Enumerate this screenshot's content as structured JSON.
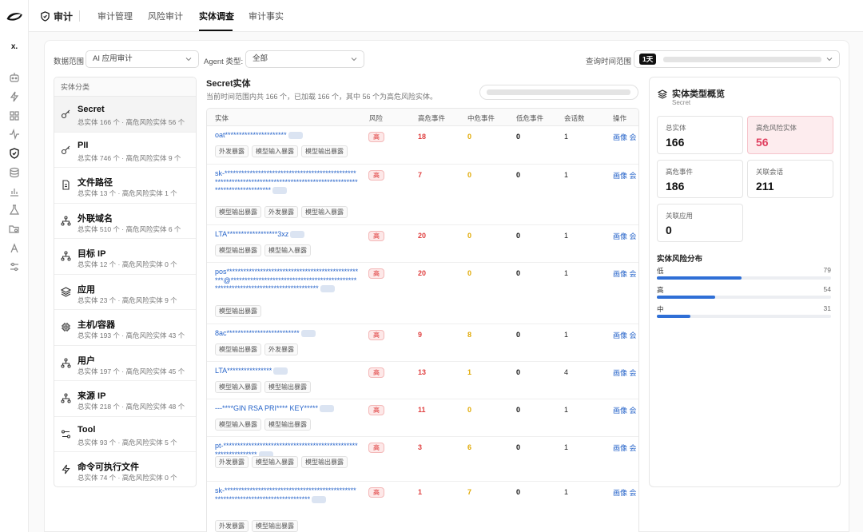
{
  "nav": {
    "brand_label": "审计",
    "tabs": [
      {
        "label": "审计管理"
      },
      {
        "label": "风险审计"
      },
      {
        "label": "实体调查"
      },
      {
        "label": "审计事实"
      }
    ],
    "active_tab": "实体调查"
  },
  "rail": {
    "workspace_badge": "x.",
    "icons": [
      "robot-icon",
      "bolt-icon",
      "grid-icon",
      "pulse-icon",
      "shield-check-icon",
      "database-icon",
      "bar-chart-icon",
      "flask-icon",
      "folder-search-icon",
      "activity-icon",
      "sliders-icon"
    ],
    "active_icon": "shield-check-icon"
  },
  "filters": {
    "scope_label": "数据范围",
    "scope_value": "AI 应用审计",
    "agent_label": "Agent 类型:",
    "agent_value": "全部",
    "time_label": "查询时间范围",
    "time_badge": "1天"
  },
  "categories": {
    "header": "实体分类",
    "selected": "Secret",
    "items": [
      {
        "name": "Secret",
        "summary": "总实体 166 个 · 高危风险实体 56 个",
        "icon": "key-icon"
      },
      {
        "name": "PII",
        "summary": "总实体 746 个 · 高危风险实体 9 个",
        "icon": "key-icon"
      },
      {
        "name": "文件路径",
        "summary": "总实体 13 个 · 高危风险实体 1 个",
        "icon": "file-icon"
      },
      {
        "name": "外联域名",
        "summary": "总实体 510 个 · 高危风险实体 6 个",
        "icon": "network-icon"
      },
      {
        "name": "目标 IP",
        "summary": "总实体 12 个 · 高危风险实体 0 个",
        "icon": "network-icon"
      },
      {
        "name": "应用",
        "summary": "总实体 23 个 · 高危风险实体 9 个",
        "icon": "layers-icon"
      },
      {
        "name": "主机/容器",
        "summary": "总实体 193 个 · 高危风险实体 43 个",
        "icon": "chip-icon"
      },
      {
        "name": "用户",
        "summary": "总实体 197 个 · 高危风险实体 45 个",
        "icon": "network-icon"
      },
      {
        "name": "来源 IP",
        "summary": "总实体 218 个 · 高危风险实体 48 个",
        "icon": "network-icon"
      },
      {
        "name": "Tool",
        "summary": "总实体 93 个 · 高危风险实体 5 个",
        "icon": "tool-icon"
      },
      {
        "name": "命令可执行文件",
        "summary": "总实体 74 个 · 高危风险实体 0 个",
        "icon": "bolt-icon"
      }
    ]
  },
  "entities": {
    "title": "Secret实体",
    "subtitle": "当前时间范围内共 166 个，已加载 166 个，其中 56 个为高危风险实体。",
    "columns": [
      "实体",
      "风险",
      "高危事件",
      "中危事件",
      "低危事件",
      "会话数",
      "操作"
    ],
    "rows": [
      {
        "entity": "oat**********************",
        "risk": "高",
        "high": "18",
        "mid": "0",
        "low": "0",
        "sessions": "1",
        "tags": [
          "外发暴露",
          "模型输入暴露",
          "模型输出暴露"
        ],
        "ops": "画像 会"
      },
      {
        "entity": "sk-**********************************************************************************************************************",
        "risk": "高",
        "high": "7",
        "mid": "0",
        "low": "0",
        "sessions": "1",
        "tags": [
          "模型输出暴露",
          "外发暴露",
          "模型输入暴露"
        ],
        "ops": "画像 会"
      },
      {
        "entity": "LTA******************3xz",
        "risk": "高",
        "high": "20",
        "mid": "0",
        "low": "0",
        "sessions": "1",
        "tags": [
          "模型输出暴露",
          "模型输入暴露"
        ],
        "ops": "画像 会"
      },
      {
        "entity": "pos**************************************************@**********************************************************************************",
        "risk": "高",
        "high": "20",
        "mid": "0",
        "low": "0",
        "sessions": "1",
        "tags": [
          "模型输出暴露"
        ],
        "ops": "画像 会"
      },
      {
        "entity": "8ac**************************",
        "risk": "高",
        "high": "9",
        "mid": "8",
        "low": "0",
        "sessions": "1",
        "tags": [
          "模型输出暴露",
          "外发暴露"
        ],
        "ops": "画像 会"
      },
      {
        "entity": "LTA****************",
        "risk": "高",
        "high": "13",
        "mid": "1",
        "low": "0",
        "sessions": "4",
        "tags": [
          "模型输入暴露",
          "模型输出暴露"
        ],
        "ops": "画像 会"
      },
      {
        "entity": "---****GIN RSA PRI**** KEY*****",
        "risk": "高",
        "high": "11",
        "mid": "0",
        "low": "0",
        "sessions": "1",
        "tags": [
          "模型输入暴露",
          "模型输出暴露"
        ],
        "ops": "画像 会"
      },
      {
        "entity": "pt-***************************************************************",
        "risk": "高",
        "high": "3",
        "mid": "6",
        "low": "0",
        "sessions": "1",
        "tags": [
          "外发暴露",
          "模型输入暴露",
          "模型输出暴露"
        ],
        "ops": "画像 会"
      },
      {
        "entity": "sk-*********************************************************************************",
        "risk": "高",
        "high": "1",
        "mid": "7",
        "low": "0",
        "sessions": "1",
        "tags": [
          "外发暴露",
          "模型输出暴露"
        ],
        "ops": "画像 会"
      }
    ]
  },
  "overview": {
    "title": "实体类型概览",
    "subtitle": "Secret",
    "stats": [
      {
        "label": "总实体",
        "value": "166"
      },
      {
        "label": "高危风险实体",
        "value": "56"
      },
      {
        "label": "高危事件",
        "value": "186"
      },
      {
        "label": "关联会话",
        "value": "211"
      },
      {
        "label": "关联应用",
        "value": "0"
      }
    ],
    "dist_title": "实体风险分布",
    "dist": [
      {
        "label": "低",
        "value": 79,
        "fraction": 0.486
      },
      {
        "label": "高",
        "value": 54,
        "fraction": 0.333
      },
      {
        "label": "中",
        "value": 31,
        "fraction": 0.191
      }
    ]
  },
  "colors": {
    "link": "#2563c9",
    "high": "#e04040",
    "mid": "#e0a800",
    "bar": "#2f6fd6",
    "highlight_card": "#fdecee"
  }
}
